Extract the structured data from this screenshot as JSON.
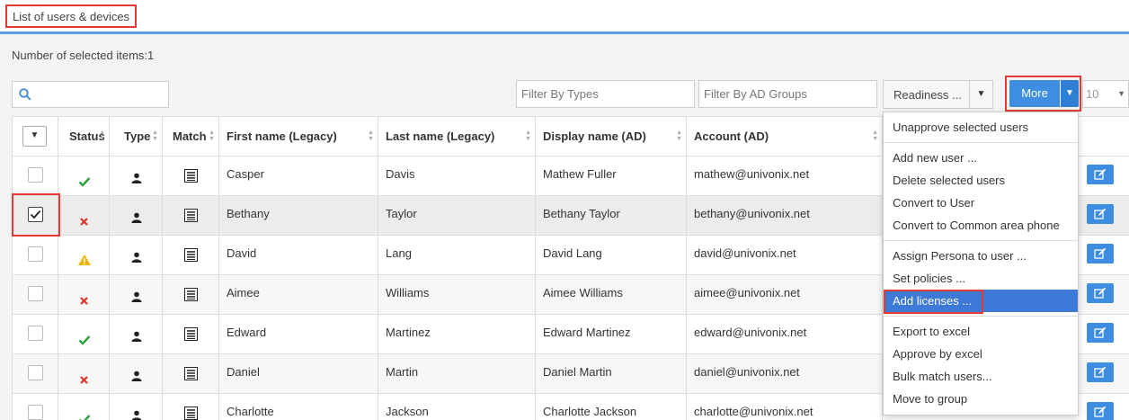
{
  "page": {
    "title": "List of users & devices"
  },
  "selection": {
    "count_text": "Number of selected items:1"
  },
  "toolbar": {
    "search_icon": "magnifier-icon",
    "filter_types_placeholder": "Filter By Types",
    "filter_groups_placeholder": "Filter By AD Groups",
    "readiness_label": "Readiness ...",
    "more_label": "More",
    "page_size": "10"
  },
  "table": {
    "columns": [
      "Status",
      "Type",
      "Match",
      "First name (Legacy)",
      "Last name (Legacy)",
      "Display name (AD)",
      "Account (AD)"
    ],
    "rows": [
      {
        "checked": false,
        "status": "ok",
        "first": "Casper",
        "last": "Davis",
        "display": "Mathew Fuller",
        "account": "mathew@univonix.net"
      },
      {
        "checked": true,
        "status": "error",
        "first": "Bethany",
        "last": "Taylor",
        "display": "Bethany Taylor",
        "account": "bethany@univonix.net"
      },
      {
        "checked": false,
        "status": "warning",
        "first": "David",
        "last": "Lang",
        "display": "David Lang",
        "account": "david@univonix.net"
      },
      {
        "checked": false,
        "status": "error",
        "first": "Aimee",
        "last": "Williams",
        "display": "Aimee Williams",
        "account": "aimee@univonix.net"
      },
      {
        "checked": false,
        "status": "ok",
        "first": "Edward",
        "last": "Martinez",
        "display": "Edward Martinez",
        "account": "edward@univonix.net"
      },
      {
        "checked": false,
        "status": "error",
        "first": "Daniel",
        "last": "Martin",
        "display": "Daniel Martin",
        "account": "daniel@univonix.net"
      },
      {
        "checked": false,
        "status": "ok",
        "first": "Charlotte",
        "last": "Jackson",
        "display": "Charlotte Jackson",
        "account": "charlotte@univonix.net"
      }
    ]
  },
  "more_menu": {
    "groups": [
      [
        "Unapprove selected users"
      ],
      [
        "Add new user ...",
        "Delete selected users",
        "Convert to User",
        "Convert to Common area phone"
      ],
      [
        "Assign Persona to user ...",
        "Set policies ...",
        "Add licenses ..."
      ],
      [
        "Export to excel",
        "Approve by excel",
        "Bulk match users...",
        "Move to group"
      ]
    ],
    "active_item": "Add licenses ..."
  },
  "colors": {
    "accent": "#3d8de0",
    "highlight": "#e53935",
    "ok": "#2e9e3e",
    "error": "#d9342b",
    "warning": "#f0b400"
  }
}
